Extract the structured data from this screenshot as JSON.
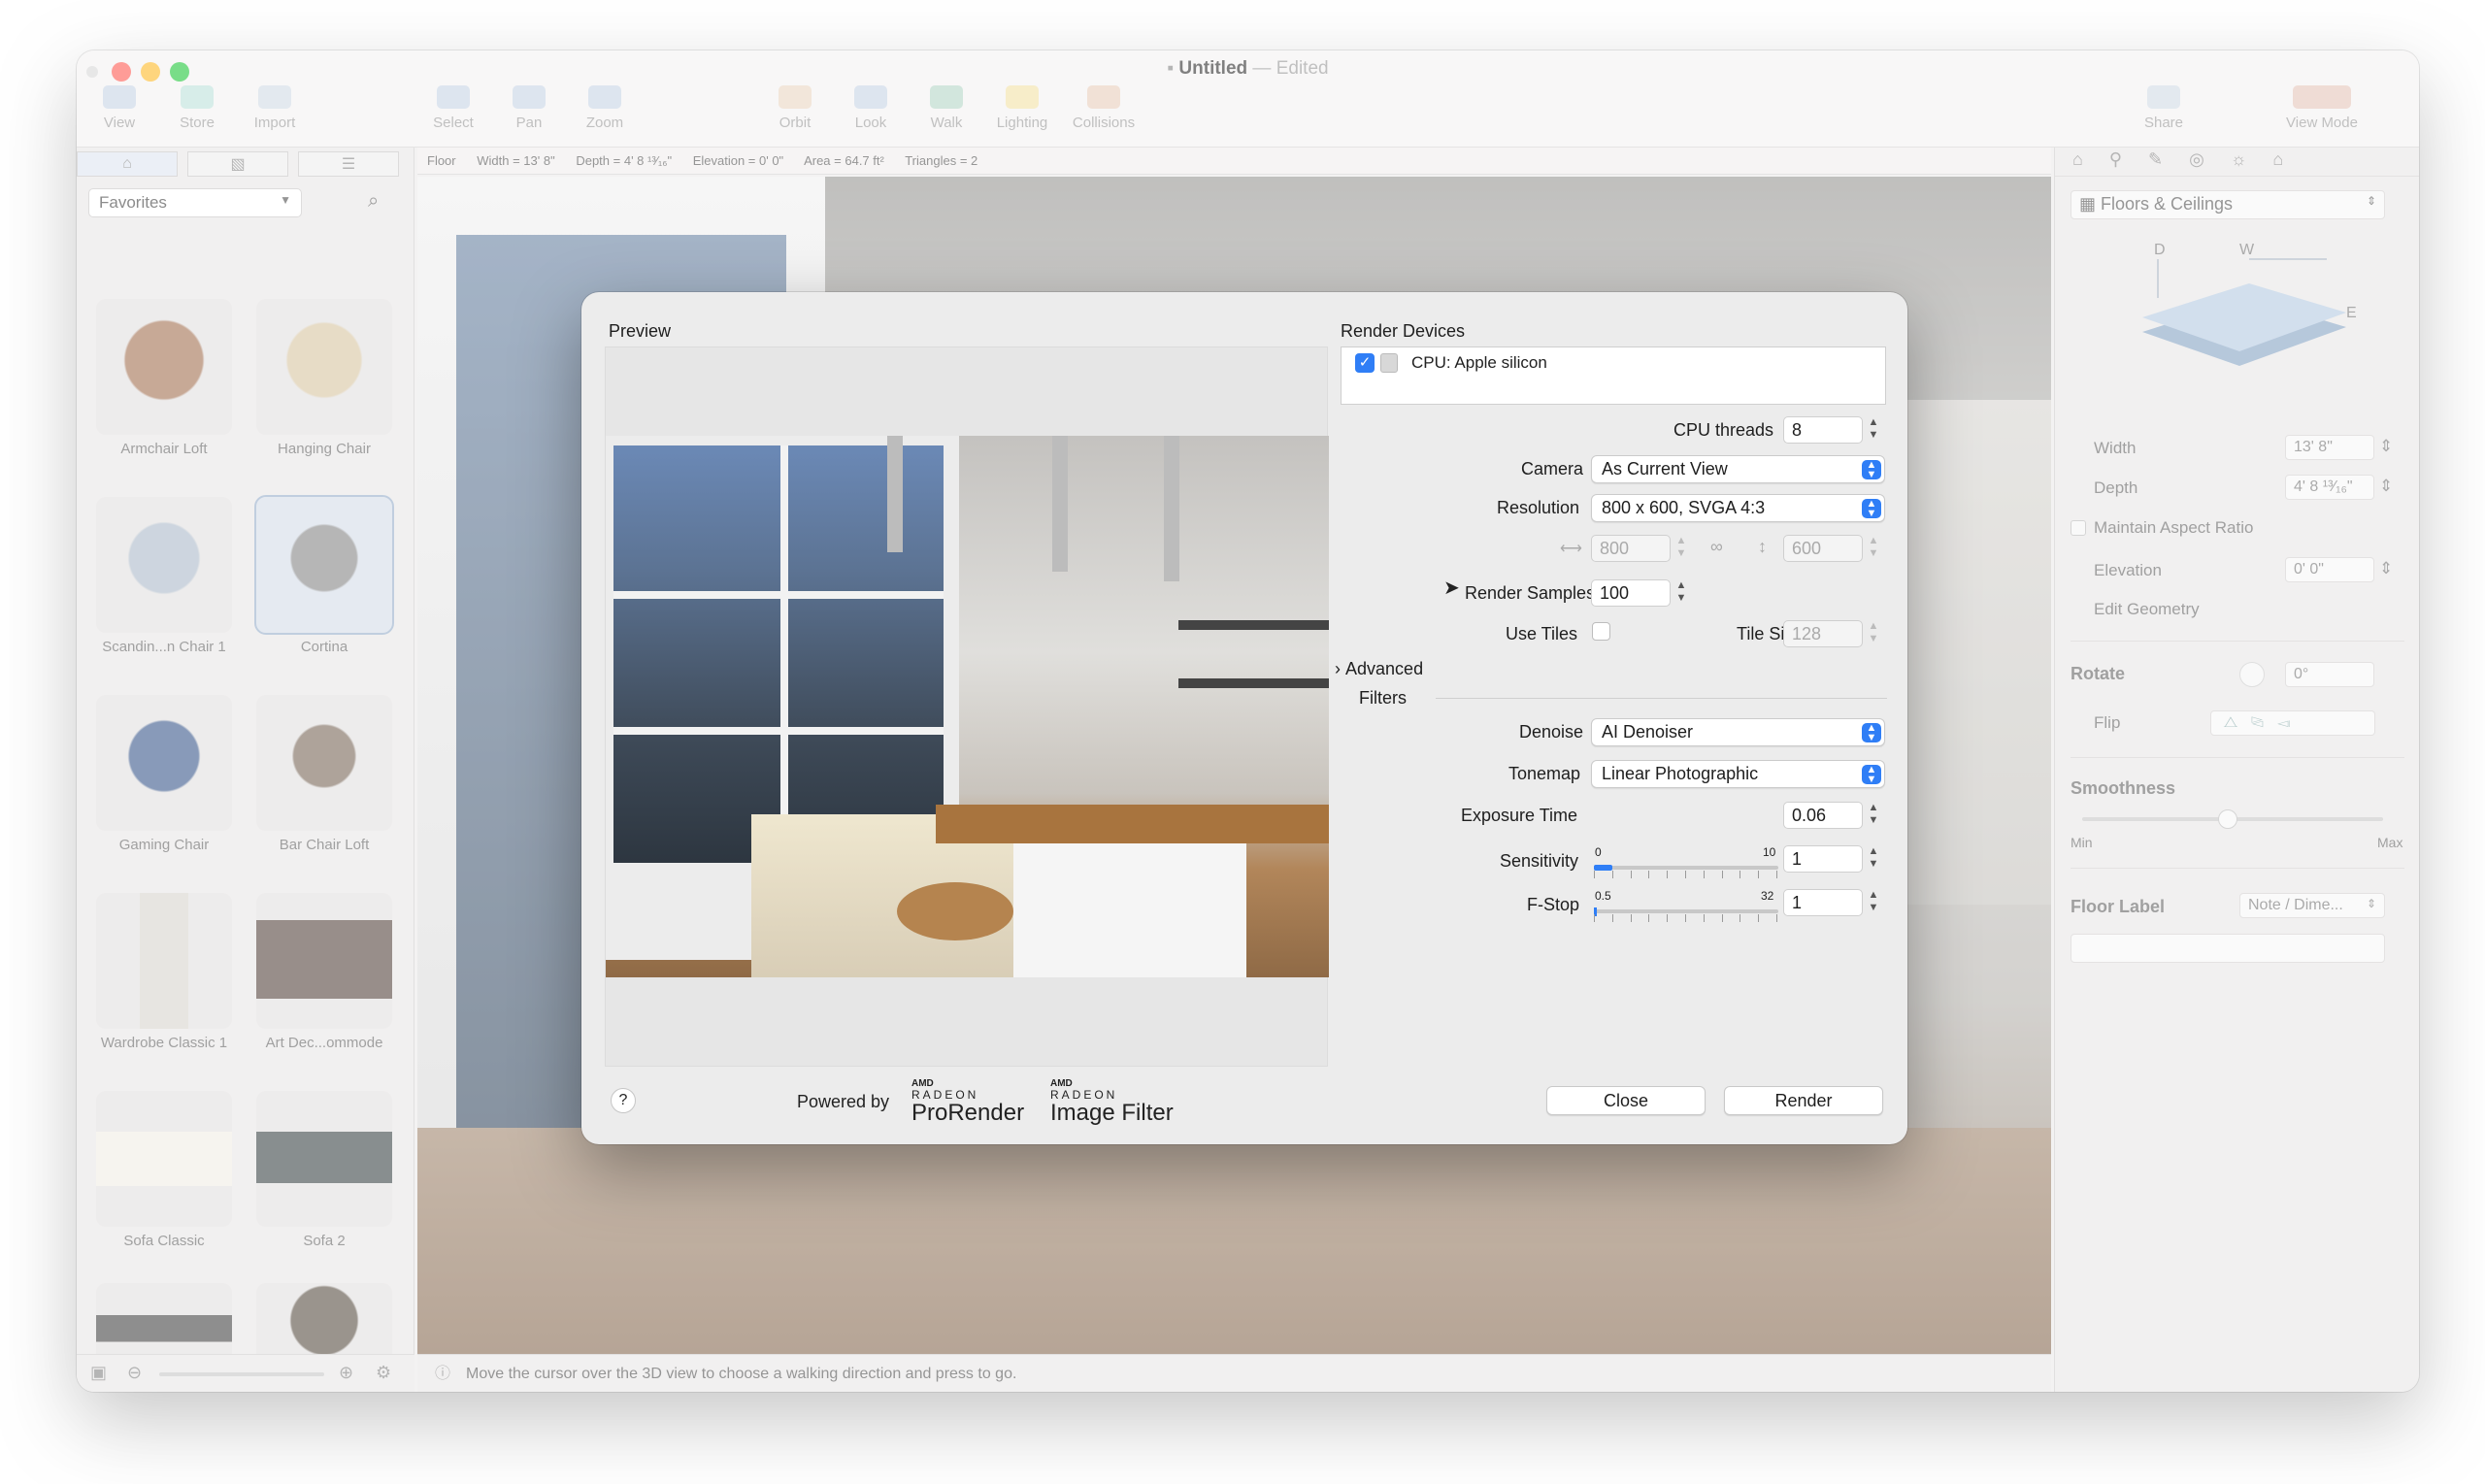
{
  "window": {
    "title": "Untitled",
    "title_suffix": "— Edited",
    "toolbar": [
      {
        "label": "View",
        "icon": "view-icon"
      },
      {
        "label": "Store",
        "icon": "cart-icon"
      },
      {
        "label": "Import",
        "icon": "import-icon"
      },
      {
        "label": "Select",
        "icon": "cursor-icon"
      },
      {
        "label": "Pan",
        "icon": "hand-icon"
      },
      {
        "label": "Zoom",
        "icon": "magnifier-icon"
      },
      {
        "label": "Orbit",
        "icon": "orbit-icon"
      },
      {
        "label": "Look",
        "icon": "eye-icon"
      },
      {
        "label": "Walk",
        "icon": "walk-icon"
      },
      {
        "label": "Lighting",
        "icon": "bulb-icon"
      },
      {
        "label": "Collisions",
        "icon": "collision-icon"
      },
      {
        "label": "Share",
        "icon": "share-icon"
      },
      {
        "label": "View Mode",
        "icon": "view-mode-icon"
      }
    ]
  },
  "infobar": {
    "type": "Floor",
    "width": "Width = 13' 8\"",
    "depth": "Depth = 4' 8 ¹³⁄₁₆\"",
    "elevation": "Elevation = 0' 0\"",
    "area": "Area = 64.7 ft²",
    "triangles": "Triangles = 2"
  },
  "library": {
    "category": "Favorites",
    "items": [
      {
        "label": "Armchair Loft"
      },
      {
        "label": "Hanging Chair"
      },
      {
        "label": "Scandin...n Chair 1"
      },
      {
        "label": "Cortina"
      },
      {
        "label": "Gaming Chair"
      },
      {
        "label": "Bar Chair Loft"
      },
      {
        "label": "Wardrobe Classic 1"
      },
      {
        "label": "Art Dec...ommode"
      },
      {
        "label": "Sofa Classic"
      },
      {
        "label": "Sofa 2"
      }
    ]
  },
  "statusbar": {
    "text": "Move the cursor over the 3D view to choose a walking direction and press to go."
  },
  "inspector": {
    "section": "Floors & Ceilings",
    "diagram_labels": {
      "d": "D",
      "w": "W",
      "e": "E"
    },
    "width_label": "Width",
    "width_value": "13' 8\"",
    "depth_label": "Depth",
    "depth_value": "4' 8 ¹³⁄₁₆\"",
    "aspect_label": "Maintain Aspect Ratio",
    "elevation_label": "Elevation",
    "elevation_value": "0' 0\"",
    "edit_geometry": "Edit Geometry",
    "rotate_label": "Rotate",
    "rotate_value": "0°",
    "flip_label": "Flip",
    "smoothness_label": "Smoothness",
    "smooth_min": "Min",
    "smooth_max": "Max",
    "floor_label_heading": "Floor Label",
    "floor_label_value": "Note / Dime..."
  },
  "dialog": {
    "preview_label": "Preview",
    "render_devices_label": "Render Devices",
    "device": "CPU: Apple silicon",
    "device_checked": true,
    "cpu_threads_label": "CPU threads",
    "cpu_threads": "8",
    "camera_label": "Camera",
    "camera": "As Current View",
    "resolution_label": "Resolution",
    "resolution": "800 x 600, SVGA 4:3",
    "res_width": "800",
    "res_height": "600",
    "render_samples_label": "Render Samples",
    "render_samples": "100",
    "use_tiles_label": "Use Tiles",
    "tile_size_label": "Tile Size",
    "tile_size": "128",
    "advanced_label": "Advanced",
    "filters_label": "Filters",
    "denoise_label": "Denoise",
    "denoise": "AI Denoiser",
    "tonemap_label": "Tonemap",
    "tonemap": "Linear Photographic",
    "exposure_label": "Exposure Time",
    "exposure": "0.06",
    "sensitivity_label": "Sensitivity",
    "sensitivity_min": "0",
    "sensitivity_max": "10",
    "sensitivity": "1",
    "fstop_label": "F-Stop",
    "fstop_min": "0.5",
    "fstop_max": "32",
    "fstop": "1",
    "help": "?",
    "powered_by": "Powered by",
    "brand1_top": "AMD",
    "brand1_mid": "RADEON",
    "brand1_name": "ProRender",
    "brand2_top": "AMD",
    "brand2_mid": "RADEON",
    "brand2_name": "Image Filter",
    "close": "Close",
    "render": "Render"
  },
  "colors": {
    "accent": "#2f7ef6"
  }
}
